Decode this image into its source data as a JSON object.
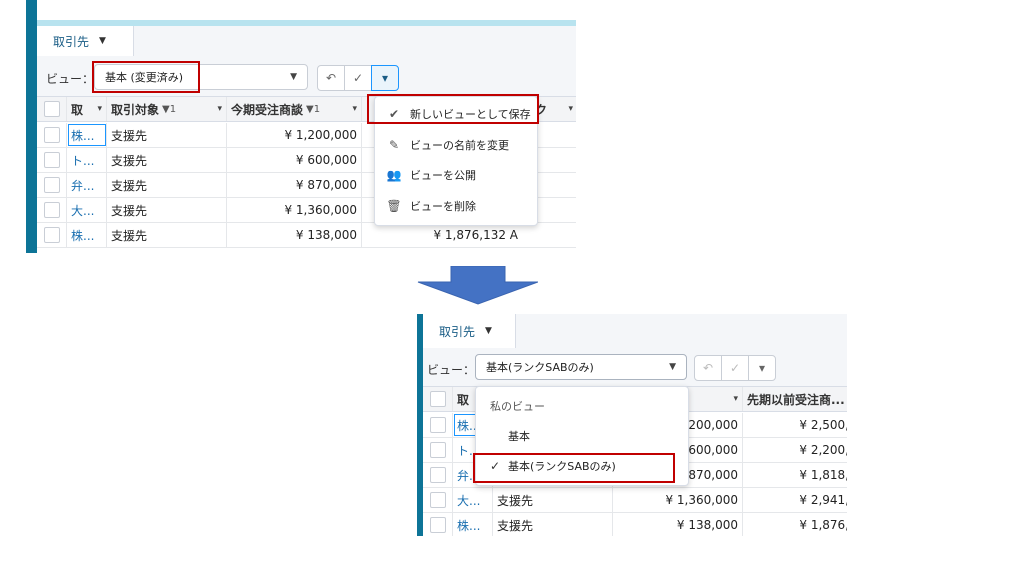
{
  "before": {
    "tab_label": "取引先",
    "view_label": "ビュー：",
    "view_value": "基本 (変更済み)",
    "buttons": [
      "↶",
      "✓",
      "▾"
    ],
    "columns": [
      {
        "label": "取",
        "filter": "",
        "dd": "▾"
      },
      {
        "label": "取引対象",
        "filter": "▼1",
        "dd": "▾"
      },
      {
        "label": "今期受注商談",
        "filter": "▼1",
        "dd": "▾"
      },
      {
        "label": "ランク",
        "filter": "",
        "dd": "▾"
      }
    ],
    "rows": [
      {
        "name": "株...",
        "type": "支援先",
        "amount": "¥ 1,200,000",
        "extra": ""
      },
      {
        "name": "ト...",
        "type": "支援先",
        "amount": "¥ 600,000",
        "extra": ""
      },
      {
        "name": "弁...",
        "type": "支援先",
        "amount": "¥ 870,000",
        "extra": ""
      },
      {
        "name": "大...",
        "type": "支援先",
        "amount": "¥ 1,360,000",
        "extra": ""
      },
      {
        "name": "株...",
        "type": "支援先",
        "amount": "¥ 138,000",
        "extra": "¥ 1,876,132 A"
      }
    ],
    "menu": [
      {
        "icon": "check-circle-icon",
        "glyph": "✔",
        "label": "新しいビューとして保存"
      },
      {
        "icon": "pencil-icon",
        "glyph": "✎",
        "label": "ビューの名前を変更"
      },
      {
        "icon": "people-icon",
        "glyph": "👥",
        "label": "ビューを公開"
      },
      {
        "icon": "trash-icon",
        "glyph": "🗑",
        "label": "ビューを削除"
      }
    ]
  },
  "after": {
    "tab_label": "取引先",
    "view_label": "ビュー：",
    "view_value": "基本(ランクSABのみ)",
    "buttons": [
      "↶",
      "✓",
      "▾"
    ],
    "columns": [
      {
        "label": "取",
        "filter": "",
        "dd": "▾"
      },
      {
        "label": "",
        "filter": "▼1",
        "dd": "▾"
      },
      {
        "label": "先期以前受注商...",
        "filter": "",
        "dd": ""
      }
    ],
    "rows": [
      {
        "name": "株...",
        "type": "",
        "amount": "200,000",
        "prev": "¥ 2,500,"
      },
      {
        "name": "ト...",
        "type": "",
        "amount": "600,000",
        "prev": "¥ 2,200,"
      },
      {
        "name": "弁...",
        "type": "",
        "amount": "870,000",
        "prev": "¥ 1,818,"
      },
      {
        "name": "大...",
        "type": "支援先",
        "amount": "¥ 1,360,000",
        "prev": "¥ 2,941,"
      },
      {
        "name": "株...",
        "type": "支援先",
        "amount": "¥ 138,000",
        "prev": "¥ 1,876,"
      }
    ],
    "dropdown": {
      "header": "私のビュー",
      "items": [
        "基本",
        "基本(ランクSABのみ)"
      ],
      "checkmark": "✓"
    }
  },
  "colors": {
    "accent": "#0d7497",
    "highlight": "#c00000",
    "arrow": "#4472c4",
    "link": "#1a6fb0"
  }
}
